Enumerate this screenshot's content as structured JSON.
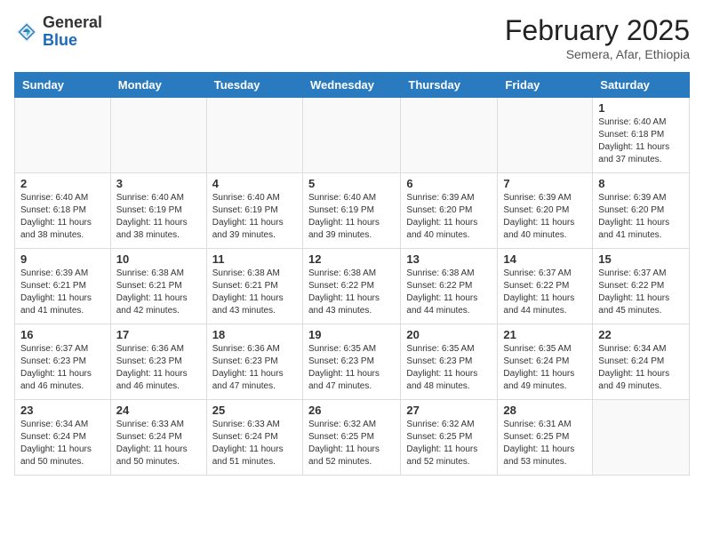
{
  "header": {
    "logo_general": "General",
    "logo_blue": "Blue",
    "month_year": "February 2025",
    "location": "Semera, Afar, Ethiopia"
  },
  "weekdays": [
    "Sunday",
    "Monday",
    "Tuesday",
    "Wednesday",
    "Thursday",
    "Friday",
    "Saturday"
  ],
  "weeks": [
    [
      {
        "day": "",
        "info": ""
      },
      {
        "day": "",
        "info": ""
      },
      {
        "day": "",
        "info": ""
      },
      {
        "day": "",
        "info": ""
      },
      {
        "day": "",
        "info": ""
      },
      {
        "day": "",
        "info": ""
      },
      {
        "day": "1",
        "info": "Sunrise: 6:40 AM\nSunset: 6:18 PM\nDaylight: 11 hours\nand 37 minutes."
      }
    ],
    [
      {
        "day": "2",
        "info": "Sunrise: 6:40 AM\nSunset: 6:18 PM\nDaylight: 11 hours\nand 38 minutes."
      },
      {
        "day": "3",
        "info": "Sunrise: 6:40 AM\nSunset: 6:19 PM\nDaylight: 11 hours\nand 38 minutes."
      },
      {
        "day": "4",
        "info": "Sunrise: 6:40 AM\nSunset: 6:19 PM\nDaylight: 11 hours\nand 39 minutes."
      },
      {
        "day": "5",
        "info": "Sunrise: 6:40 AM\nSunset: 6:19 PM\nDaylight: 11 hours\nand 39 minutes."
      },
      {
        "day": "6",
        "info": "Sunrise: 6:39 AM\nSunset: 6:20 PM\nDaylight: 11 hours\nand 40 minutes."
      },
      {
        "day": "7",
        "info": "Sunrise: 6:39 AM\nSunset: 6:20 PM\nDaylight: 11 hours\nand 40 minutes."
      },
      {
        "day": "8",
        "info": "Sunrise: 6:39 AM\nSunset: 6:20 PM\nDaylight: 11 hours\nand 41 minutes."
      }
    ],
    [
      {
        "day": "9",
        "info": "Sunrise: 6:39 AM\nSunset: 6:21 PM\nDaylight: 11 hours\nand 41 minutes."
      },
      {
        "day": "10",
        "info": "Sunrise: 6:38 AM\nSunset: 6:21 PM\nDaylight: 11 hours\nand 42 minutes."
      },
      {
        "day": "11",
        "info": "Sunrise: 6:38 AM\nSunset: 6:21 PM\nDaylight: 11 hours\nand 43 minutes."
      },
      {
        "day": "12",
        "info": "Sunrise: 6:38 AM\nSunset: 6:22 PM\nDaylight: 11 hours\nand 43 minutes."
      },
      {
        "day": "13",
        "info": "Sunrise: 6:38 AM\nSunset: 6:22 PM\nDaylight: 11 hours\nand 44 minutes."
      },
      {
        "day": "14",
        "info": "Sunrise: 6:37 AM\nSunset: 6:22 PM\nDaylight: 11 hours\nand 44 minutes."
      },
      {
        "day": "15",
        "info": "Sunrise: 6:37 AM\nSunset: 6:22 PM\nDaylight: 11 hours\nand 45 minutes."
      }
    ],
    [
      {
        "day": "16",
        "info": "Sunrise: 6:37 AM\nSunset: 6:23 PM\nDaylight: 11 hours\nand 46 minutes."
      },
      {
        "day": "17",
        "info": "Sunrise: 6:36 AM\nSunset: 6:23 PM\nDaylight: 11 hours\nand 46 minutes."
      },
      {
        "day": "18",
        "info": "Sunrise: 6:36 AM\nSunset: 6:23 PM\nDaylight: 11 hours\nand 47 minutes."
      },
      {
        "day": "19",
        "info": "Sunrise: 6:35 AM\nSunset: 6:23 PM\nDaylight: 11 hours\nand 47 minutes."
      },
      {
        "day": "20",
        "info": "Sunrise: 6:35 AM\nSunset: 6:23 PM\nDaylight: 11 hours\nand 48 minutes."
      },
      {
        "day": "21",
        "info": "Sunrise: 6:35 AM\nSunset: 6:24 PM\nDaylight: 11 hours\nand 49 minutes."
      },
      {
        "day": "22",
        "info": "Sunrise: 6:34 AM\nSunset: 6:24 PM\nDaylight: 11 hours\nand 49 minutes."
      }
    ],
    [
      {
        "day": "23",
        "info": "Sunrise: 6:34 AM\nSunset: 6:24 PM\nDaylight: 11 hours\nand 50 minutes."
      },
      {
        "day": "24",
        "info": "Sunrise: 6:33 AM\nSunset: 6:24 PM\nDaylight: 11 hours\nand 50 minutes."
      },
      {
        "day": "25",
        "info": "Sunrise: 6:33 AM\nSunset: 6:24 PM\nDaylight: 11 hours\nand 51 minutes."
      },
      {
        "day": "26",
        "info": "Sunrise: 6:32 AM\nSunset: 6:25 PM\nDaylight: 11 hours\nand 52 minutes."
      },
      {
        "day": "27",
        "info": "Sunrise: 6:32 AM\nSunset: 6:25 PM\nDaylight: 11 hours\nand 52 minutes."
      },
      {
        "day": "28",
        "info": "Sunrise: 6:31 AM\nSunset: 6:25 PM\nDaylight: 11 hours\nand 53 minutes."
      },
      {
        "day": "",
        "info": ""
      }
    ]
  ]
}
